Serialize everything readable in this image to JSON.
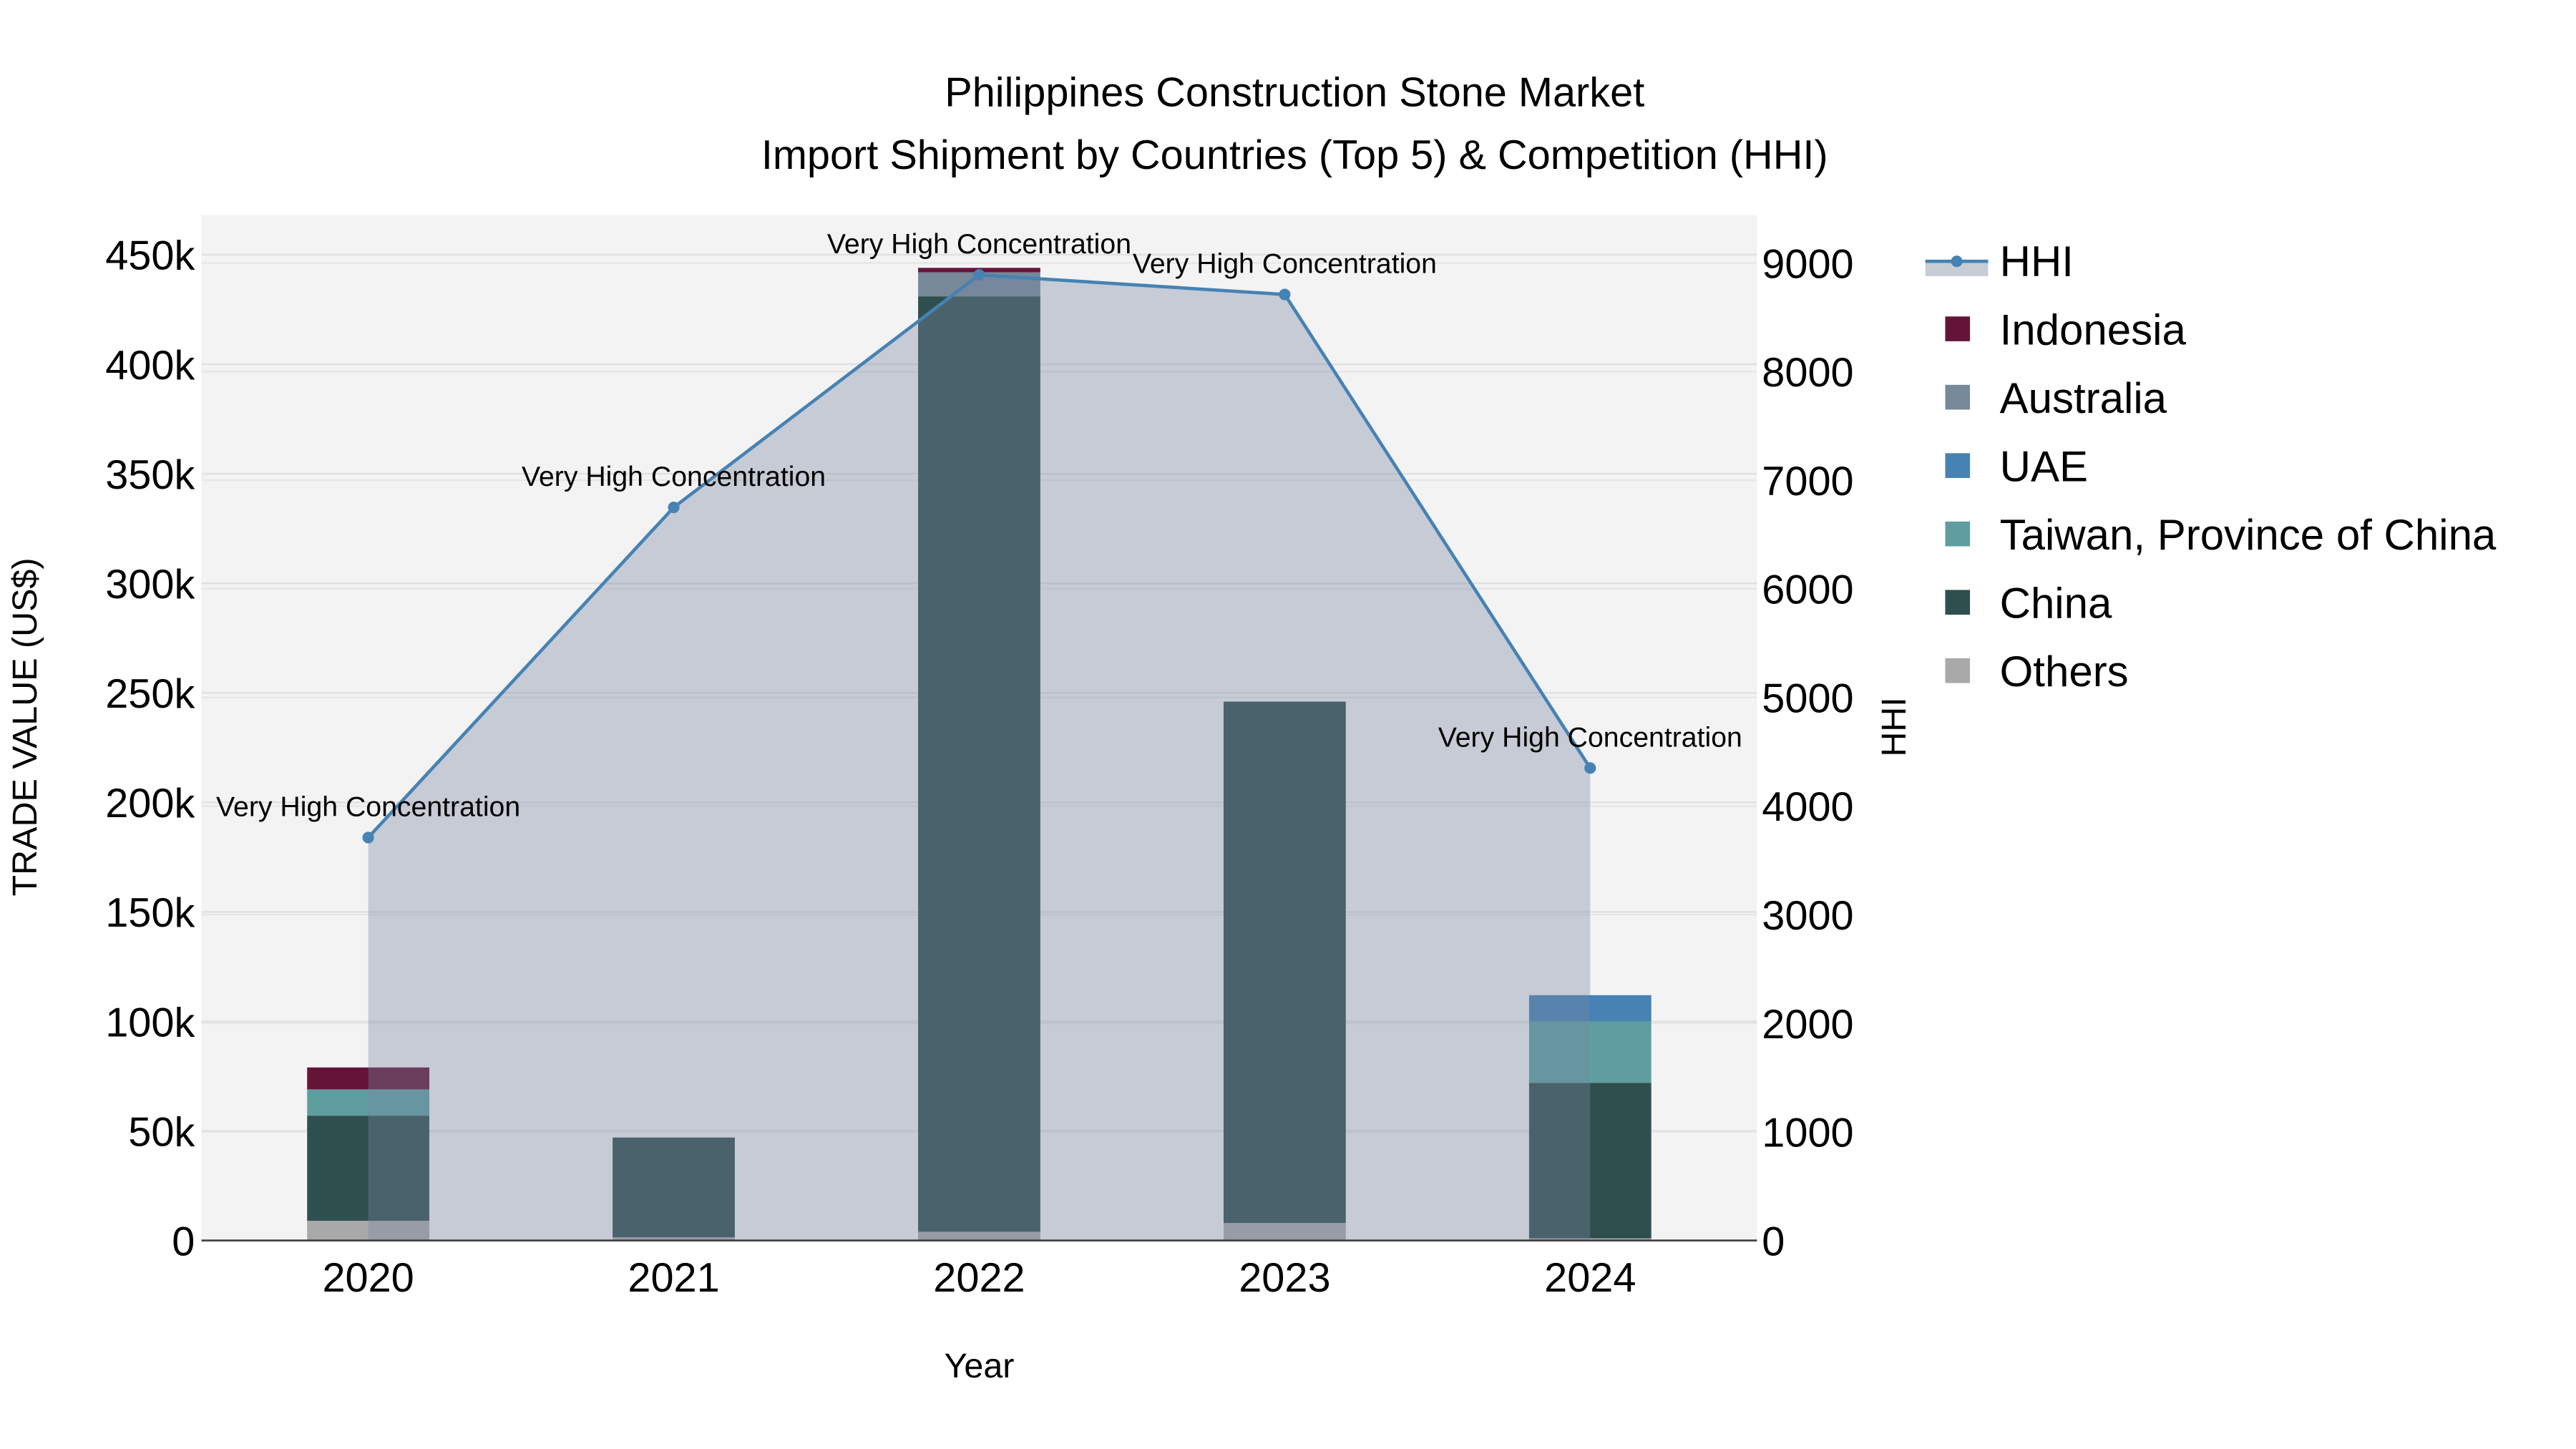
{
  "chart_data": {
    "type": "bar",
    "title": "Philippines Construction Stone Market",
    "subtitle": "Import Shipment by Countries (Top 5) & Competition (HHI)",
    "xlabel": "Year",
    "ylabel": "TRADE VALUE (US$)",
    "y2label": "HHI",
    "categories": [
      "2020",
      "2021",
      "2022",
      "2023",
      "2024"
    ],
    "ylim": [
      0,
      460000
    ],
    "y2lim": [
      0,
      9400
    ],
    "yticks": [
      0,
      50000,
      100000,
      150000,
      200000,
      250000,
      300000,
      350000,
      400000,
      450000
    ],
    "ytick_labels": [
      "0",
      "50k",
      "100k",
      "150k",
      "200k",
      "250k",
      "300k",
      "350k",
      "400k",
      "450k"
    ],
    "y2ticks": [
      0,
      1000,
      2000,
      3000,
      4000,
      5000,
      6000,
      7000,
      8000,
      9000
    ],
    "y2tick_labels": [
      "0",
      "1000",
      "2000",
      "3000",
      "4000",
      "5000",
      "6000",
      "7000",
      "8000",
      "9000"
    ],
    "stacked": true,
    "grid": true,
    "legend_position": "right",
    "series": [
      {
        "name": "Others",
        "color": "#a9a9a9",
        "values": [
          9000,
          1500,
          4000,
          8000,
          1000
        ]
      },
      {
        "name": "China",
        "color": "#2f4f4f",
        "values": [
          48000,
          45500,
          427000,
          238000,
          71000
        ]
      },
      {
        "name": "Taiwan, Province of China",
        "color": "#5f9ea0",
        "values": [
          12000,
          0,
          0,
          0,
          28000
        ]
      },
      {
        "name": "UAE",
        "color": "#4682b4",
        "values": [
          0,
          0,
          0,
          0,
          12000
        ]
      },
      {
        "name": "Australia",
        "color": "#778899",
        "values": [
          0,
          0,
          11000,
          0,
          0
        ]
      },
      {
        "name": "Indonesia",
        "color": "#641537",
        "values": [
          10000,
          0,
          2000,
          0,
          0
        ]
      }
    ],
    "hhi": {
      "name": "HHI",
      "color": "#4682b4",
      "values": [
        3710,
        6750,
        8890,
        8710,
        4350
      ],
      "annotations": [
        "Very High Concentration",
        "Very High Concentration",
        "Very High Concentration",
        "Very High Concentration",
        "Very High Concentration"
      ]
    },
    "legend_order": [
      "HHI",
      "Indonesia",
      "Australia",
      "UAE",
      "Taiwan, Province of China",
      "China",
      "Others"
    ]
  }
}
